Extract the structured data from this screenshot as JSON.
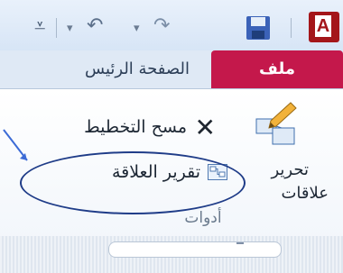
{
  "app": {
    "logo_letter": "A"
  },
  "qat": {
    "customize_icon": "customize-quick-access-icon",
    "undo_icon": "undo-icon",
    "redo_icon": "redo-icon",
    "save_icon": "save-icon"
  },
  "tabs": {
    "file": "ملف",
    "home": "الصفحة الرئيس"
  },
  "tools": {
    "clear_layout": "مسح التخطيط",
    "relationship_report": "تقرير العلاقة",
    "edit_line1": "تحرير",
    "edit_line2": "علاقات",
    "group": "أدوات"
  }
}
